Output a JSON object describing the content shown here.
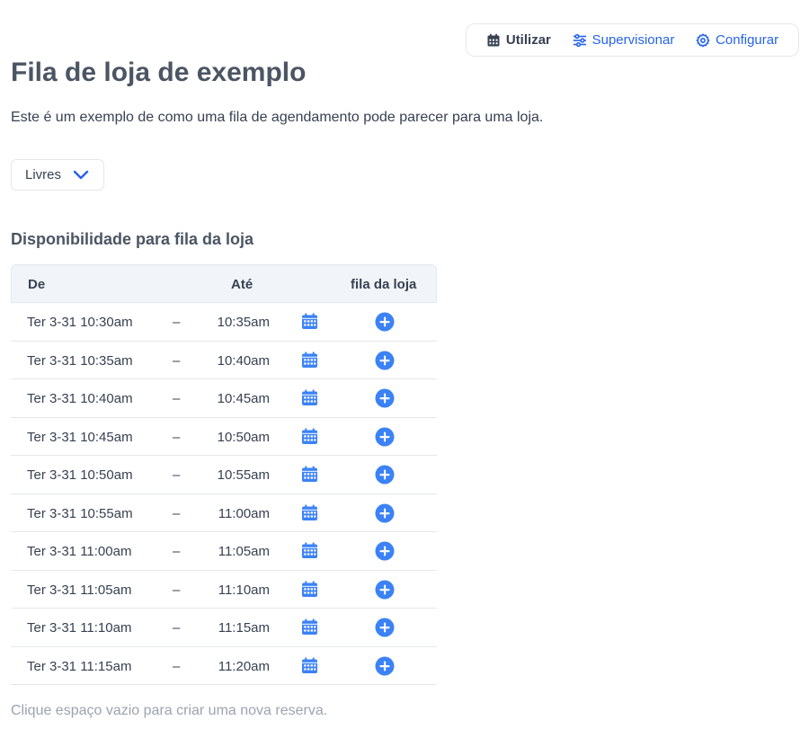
{
  "nav": {
    "items": [
      {
        "label": "Utilizar",
        "icon": "calendar-icon",
        "active": true
      },
      {
        "label": "Supervisionar",
        "icon": "sliders-icon",
        "active": false
      },
      {
        "label": "Configurar",
        "icon": "gear-icon",
        "active": false
      }
    ]
  },
  "page": {
    "title": "Fila de loja de exemplo",
    "description": "Este é um exemplo de como uma fila de agendamento pode parecer para uma loja."
  },
  "filter": {
    "selected": "Livres",
    "icon": "chevron-down-icon"
  },
  "availability": {
    "title": "Disponibilidade para fila da loja",
    "headers": {
      "from": "De",
      "to": "Até",
      "queue": "fila da loja"
    },
    "separator": "–",
    "rows": [
      {
        "from": "Ter 3-31 10:30am",
        "to": "10:35am"
      },
      {
        "from": "Ter 3-31 10:35am",
        "to": "10:40am"
      },
      {
        "from": "Ter 3-31 10:40am",
        "to": "10:45am"
      },
      {
        "from": "Ter 3-31 10:45am",
        "to": "10:50am"
      },
      {
        "from": "Ter 3-31 10:50am",
        "to": "10:55am"
      },
      {
        "from": "Ter 3-31 10:55am",
        "to": "11:00am"
      },
      {
        "from": "Ter 3-31 11:00am",
        "to": "11:05am"
      },
      {
        "from": "Ter 3-31 11:05am",
        "to": "11:10am"
      },
      {
        "from": "Ter 3-31 11:10am",
        "to": "11:15am"
      },
      {
        "from": "Ter 3-31 11:15am",
        "to": "11:20am"
      }
    ]
  },
  "footer": {
    "hint": "Clique espaço vazio para criar uma nova reserva."
  },
  "colors": {
    "accent": "#2563eb",
    "icon_blue": "#3b82f6",
    "text": "#374151",
    "muted": "#9ca3af",
    "header_bg": "#f1f5f9"
  }
}
